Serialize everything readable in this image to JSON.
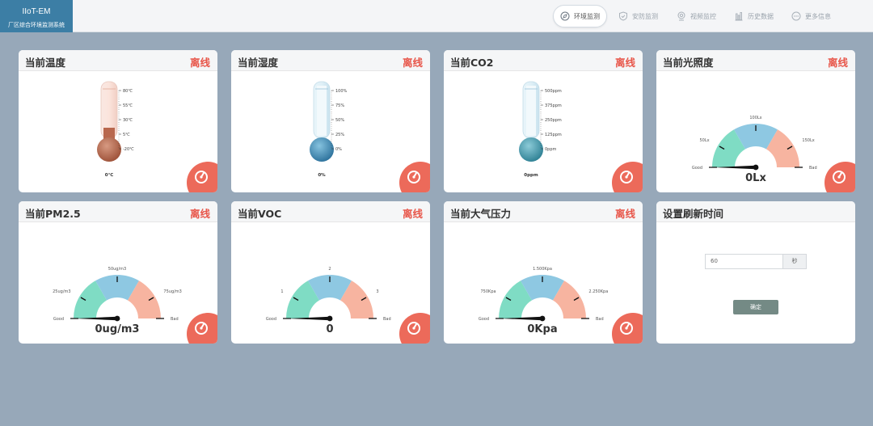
{
  "app": {
    "brand_title": "IIoT-EM",
    "brand_subtitle": "厂区综合环境监测系统"
  },
  "nav": [
    {
      "label": "环境监测",
      "icon": "compass-icon",
      "active": true
    },
    {
      "label": "安防监测",
      "icon": "shield-icon",
      "active": false
    },
    {
      "label": "视频监控",
      "icon": "camera-icon",
      "active": false
    },
    {
      "label": "历史数据",
      "icon": "bar-chart-icon",
      "active": false
    },
    {
      "label": "更多信息",
      "icon": "more-icon",
      "active": false
    }
  ],
  "status_offline": "离线",
  "cards": {
    "temperature": {
      "title": "当前温度",
      "status": "离线",
      "value": "0℃",
      "ticks": [
        "80℃",
        "55℃",
        "30℃",
        "5℃",
        "-20℃"
      ],
      "color": "#b8674d"
    },
    "humidity": {
      "title": "当前湿度",
      "status": "离线",
      "value": "0%",
      "ticks": [
        "100%",
        "75%",
        "50%",
        "25%",
        "0%"
      ],
      "color": "#3f88b6"
    },
    "co2": {
      "title": "当前CO2",
      "status": "离线",
      "value": "0ppm",
      "ticks": [
        "500ppm",
        "375ppm",
        "250ppm",
        "125ppm",
        "0ppm"
      ],
      "color": "#3f8fa8"
    },
    "light": {
      "title": "当前光照度",
      "status": "离线",
      "value": "0Lx",
      "labels": {
        "good": "Good",
        "bad": "Bad",
        "t1": "50Lx",
        "t2": "100Lx",
        "t3": "150Lx"
      }
    },
    "pm25": {
      "title": "当前PM2.5",
      "status": "离线",
      "value": "0ug/m3",
      "labels": {
        "good": "Good",
        "bad": "Bad",
        "t1": "25ug/m3",
        "t2": "50ug/m3",
        "t3": "75ug/m3"
      }
    },
    "voc": {
      "title": "当前VOC",
      "status": "离线",
      "value": "0",
      "labels": {
        "good": "Good",
        "bad": "Bad",
        "t1": "1",
        "t2": "2",
        "t3": "3"
      }
    },
    "pressure": {
      "title": "当前大气压力",
      "status": "离线",
      "value": "0Kpa",
      "labels": {
        "good": "Good",
        "bad": "Bad",
        "t1": "750Kpa",
        "t2": "1.500Kpa",
        "t3": "2.250Kpa"
      }
    },
    "refresh": {
      "title": "设置刷新时间",
      "input_value": "60",
      "unit": "秒",
      "confirm_label": "确定"
    }
  },
  "colors": {
    "good": "#7fdcc4",
    "mid": "#8ec8e2",
    "bad": "#f7b4a0",
    "offline": "#e8574b",
    "badge": "#ec6a5a"
  }
}
